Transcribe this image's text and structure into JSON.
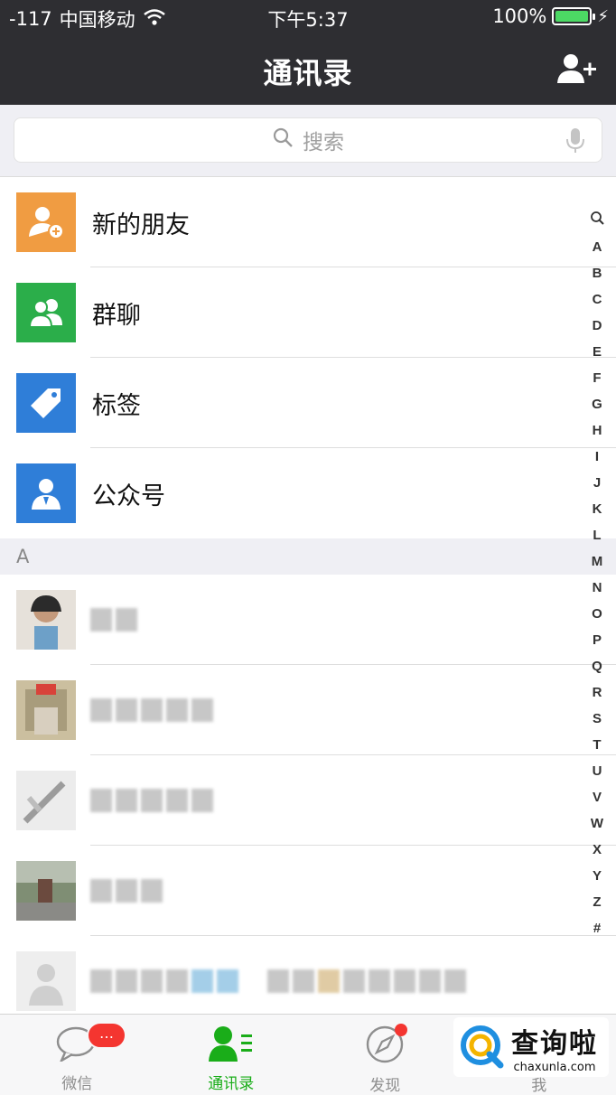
{
  "status_bar": {
    "signal": "-117",
    "carrier": "中国移动",
    "time": "下午5:37",
    "battery": "100%",
    "battery_level": 1.0,
    "battery_color": "#4cd964"
  },
  "nav": {
    "title": "通讯录",
    "add_contact_icon": "add-contact-icon"
  },
  "search": {
    "placeholder": "搜索"
  },
  "functions": [
    {
      "label": "新的朋友",
      "icon": "new-friend-icon",
      "color": "#f09c42"
    },
    {
      "label": "群聊",
      "icon": "group-chat-icon",
      "color": "#2bae4a"
    },
    {
      "label": "标签",
      "icon": "tag-icon",
      "color": "#2f7ed8"
    },
    {
      "label": "公众号",
      "icon": "official-account-icon",
      "color": "#2f7ed8"
    }
  ],
  "section": {
    "letter": "A"
  },
  "index_letters": [
    "Q",
    "A",
    "B",
    "C",
    "D",
    "E",
    "F",
    "G",
    "H",
    "I",
    "J",
    "K",
    "L",
    "M",
    "N",
    "O",
    "P",
    "Q",
    "R",
    "S",
    "T",
    "U",
    "V",
    "W",
    "X",
    "Y",
    "Z",
    "#"
  ],
  "tabs": [
    {
      "label": "微信",
      "icon": "chat-icon",
      "badge": "…"
    },
    {
      "label": "通讯录",
      "icon": "contacts-icon",
      "active": true
    },
    {
      "label": "发现",
      "icon": "compass-icon"
    },
    {
      "label": "我",
      "icon": "me-icon"
    }
  ],
  "watermark": {
    "title": "查询啦",
    "url": "chaxunla.com"
  },
  "colors": {
    "accent": "#1aad19",
    "badge": "#f43530"
  }
}
